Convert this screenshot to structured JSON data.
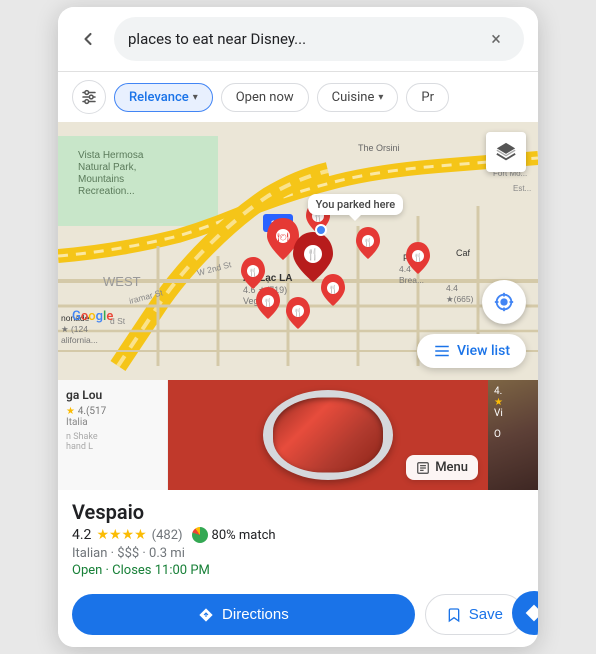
{
  "searchBar": {
    "query": "places to eat near Disney...",
    "clearLabel": "×",
    "backLabel": "←"
  },
  "filters": {
    "adjustLabel": "⚙",
    "chips": [
      {
        "label": "Relevance",
        "active": true,
        "hasArrow": true
      },
      {
        "label": "Open now",
        "active": false,
        "hasArrow": false
      },
      {
        "label": "Cuisine",
        "active": false,
        "hasArrow": true
      },
      {
        "label": "Pr",
        "active": false,
        "hasArrow": false
      }
    ]
  },
  "map": {
    "parkedLabel": "You parked here",
    "viewListLabel": "View list",
    "googleLogo": "Google",
    "layersIcon": "layers",
    "locationIcon": "my-location"
  },
  "sideCardLeft": {
    "name": "ga Lou",
    "rating": "★",
    "ratingNum": "4.",
    "count": "(517",
    "type": "Italia"
  },
  "sideCardLeft2": {
    "line1": "n Shake",
    "line2": "hand L"
  },
  "foodImage": {
    "menuLabel": "Menu",
    "menuIcon": "☰"
  },
  "restaurant": {
    "name": "Vespaio",
    "ratingNum": "4.2",
    "stars": "★★★★",
    "reviewCount": "(482)",
    "matchPercent": "80% match",
    "category": "Italian · $$$ · 0.3 mi",
    "openStatus": "Open · Closes 11:00 PM"
  },
  "actions": {
    "directionsLabel": "Directions",
    "directionsIcon": "◆",
    "saveLabel": "Save",
    "saveIcon": "🔖"
  },
  "rightCard": {
    "ratingNum": "4.",
    "stars": "★",
    "typeShort": "Vi",
    "extraLine": "O"
  }
}
